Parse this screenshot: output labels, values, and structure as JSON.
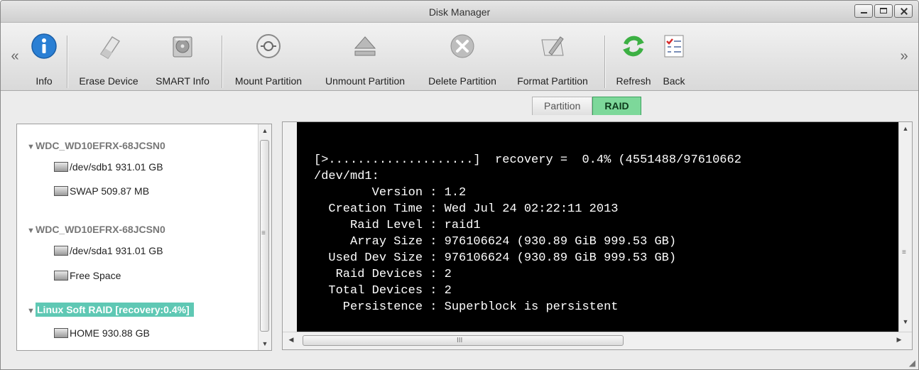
{
  "window": {
    "title": "Disk Manager"
  },
  "toolbar": {
    "items": [
      {
        "label": "Info",
        "icon": "info-icon"
      },
      {
        "label": "Erase Device",
        "icon": "eraser-icon"
      },
      {
        "label": "SMART Info",
        "icon": "hard-disk-icon"
      },
      {
        "label": "Mount Partition",
        "icon": "mount-icon"
      },
      {
        "label": "Unmount Partition",
        "icon": "eject-icon"
      },
      {
        "label": "Delete Partition",
        "icon": "delete-icon"
      },
      {
        "label": "Format Partition",
        "icon": "format-icon"
      },
      {
        "label": "Refresh",
        "icon": "refresh-icon"
      },
      {
        "label": "Back",
        "icon": "checklist-icon"
      }
    ],
    "scroll_left": "«",
    "scroll_right": "»"
  },
  "tabs": [
    {
      "label": "Partition",
      "active": false
    },
    {
      "label": "RAID",
      "active": true
    }
  ],
  "tree": {
    "disk1": {
      "label": "WDC_WD10EFRX-68JCSN0",
      "children": [
        "/dev/sdb1 931.01 GB",
        "SWAP 509.87 MB"
      ]
    },
    "disk2": {
      "label": "WDC_WD10EFRX-68JCSN0",
      "children": [
        "/dev/sda1 931.01 GB",
        "Free Space"
      ]
    },
    "raid": {
      "label": "Linux Soft RAID [recovery:0.4%]",
      "children": [
        "HOME 930.88 GB"
      ]
    }
  },
  "terminal": {
    "lines": [
      "[>....................]  recovery =  0.4% (4551488/97610662",
      "/dev/md1:",
      "        Version : 1.2",
      "  Creation Time : Wed Jul 24 02:22:11 2013",
      "     Raid Level : raid1",
      "     Array Size : 976106624 (930.89 GiB 999.53 GB)",
      "  Used Dev Size : 976106624 (930.89 GiB 999.53 GB)",
      "   Raid Devices : 2",
      "  Total Devices : 2",
      "    Persistence : Superblock is persistent"
    ],
    "hscroll_grip": "III",
    "vscroll_grip": "≡"
  },
  "colors": {
    "selected": "#5fc8b4",
    "raid_tab": "#7dd89a",
    "terminal_bg": "#000000"
  }
}
